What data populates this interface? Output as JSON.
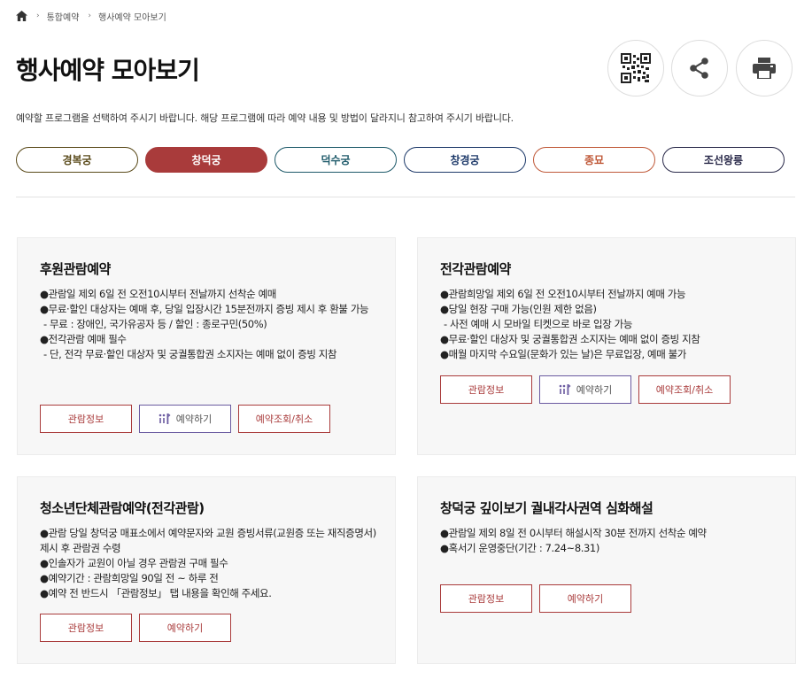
{
  "breadcrumb": {
    "items": [
      "통합예약",
      "행사예약 모아보기"
    ]
  },
  "page": {
    "title": "행사예약 모아보기",
    "description": "예약할 프로그램을 선택하여 주시기 바랍니다. 해당 프로그램에 따라 예약 내용 및 방법이 달라지니 참고하여 주시기 바랍니다."
  },
  "palaces": [
    {
      "label": "경복궁",
      "active": false
    },
    {
      "label": "창덕궁",
      "active": true
    },
    {
      "label": "덕수궁",
      "active": false
    },
    {
      "label": "창경궁",
      "active": false
    },
    {
      "label": "종묘",
      "active": false
    },
    {
      "label": "조선왕릉",
      "active": false
    }
  ],
  "cards": [
    {
      "title": "후원관람예약",
      "lines": [
        "●관람일 제외 6일 전 오전10시부터 전날까지 선착순 예매",
        "●무료·할인 대상자는 예매 후, 당일 입장시간 15분전까지 증빙 제시 후 환불 가능",
        "  - 무료 : 장애인, 국가유공자 등 / 할인 : 종로구민(50%)",
        "●전각관람 예매 필수",
        "  - 단, 전각 무료·할인 대상자 및 궁궐통합권 소지자는 예매 없이 증빙 지참"
      ],
      "buttons": [
        "관람정보",
        "예약하기",
        "예약조회/취소"
      ]
    },
    {
      "title": "전각관람예약",
      "lines": [
        "●관람희망일 제외 6일 전 오전10시부터 전날까지 예매 가능",
        "●당일 현장 구매 가능(인원 제한 없음)",
        "  - 사전 예매 시 모바일 티켓으로 바로 입장 가능",
        "●무료·할인 대상자 및 궁궐통합권 소지자는 예매 없이 증빙 지참",
        "●매월 마지막 수요일(문화가 있는 날)은 무료입장, 예매 불가"
      ],
      "buttons": [
        "관람정보",
        "예약하기",
        "예약조회/취소"
      ]
    },
    {
      "title": "청소년단체관람예약(전각관람)",
      "lines": [
        "●관람 당일 창덕궁 매표소에서 예약문자와 교원 증빙서류(교원증 또는 재직증명서)제시 후 관람권 수령",
        "●인솔자가 교원이 아닐 경우 관람권 구매 필수",
        "●예약기간 : 관람희망일 90일 전 ~ 하루 전",
        "●예약 전 반드시 「관람정보」 탭 내용을 확인해 주세요."
      ],
      "buttons": [
        "관람정보",
        "예약하기"
      ]
    },
    {
      "title": "창덕궁 깊이보기 궐내각사권역 심화해설",
      "lines": [
        "●관람일 제외 8일 전 0시부터 해설시작 30분 전까지 선착순 예약",
        "●혹서기 운영중단(기간 : 7.24~8.31)"
      ],
      "buttons": [
        "관람정보",
        "예약하기"
      ]
    }
  ],
  "icons": [
    "home-icon",
    "qr-code-icon",
    "share-icon",
    "print-icon",
    "reservation-mark-icon"
  ],
  "colors": {
    "accent": "#a93b3b",
    "card_bg": "#f7f7f7"
  }
}
